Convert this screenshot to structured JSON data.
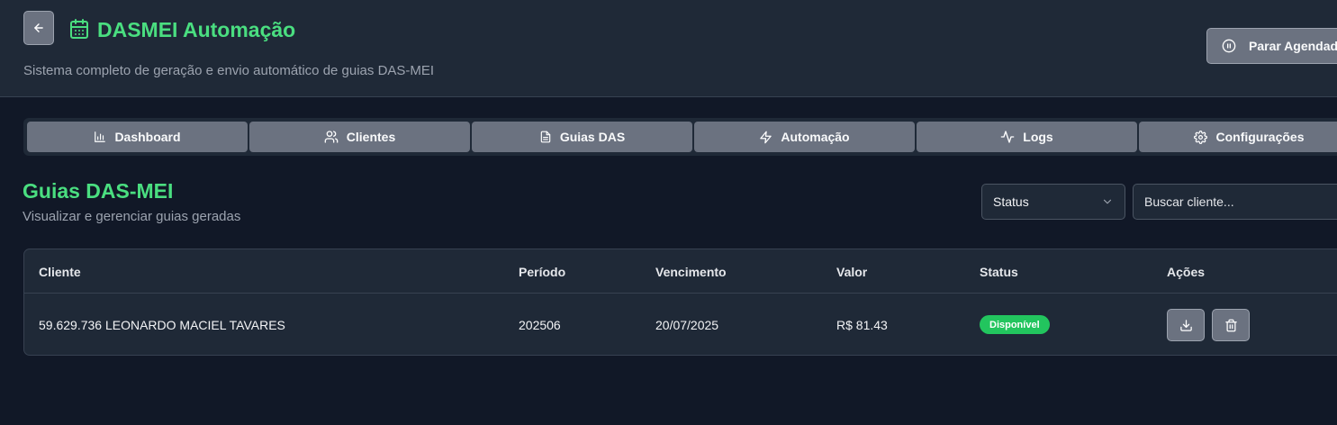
{
  "header": {
    "title": "DASMEI Automação",
    "subtitle": "Sistema completo de geração e envio automático de guias DAS-MEI",
    "stop_button": "Parar Agendador"
  },
  "tabs": [
    {
      "label": "Dashboard",
      "icon": "bar-chart-icon"
    },
    {
      "label": "Clientes",
      "icon": "users-icon"
    },
    {
      "label": "Guias DAS",
      "icon": "file-text-icon"
    },
    {
      "label": "Automação",
      "icon": "zap-icon"
    },
    {
      "label": "Logs",
      "icon": "activity-icon"
    },
    {
      "label": "Configurações",
      "icon": "gear-icon"
    }
  ],
  "section": {
    "title": "Guias DAS-MEI",
    "subtitle": "Visualizar e gerenciar guias geradas"
  },
  "filters": {
    "status_label": "Status",
    "search_placeholder": "Buscar cliente..."
  },
  "table": {
    "headers": {
      "cliente": "Cliente",
      "periodo": "Período",
      "vencimento": "Vencimento",
      "valor": "Valor",
      "status": "Status",
      "acoes": "Ações"
    },
    "rows": [
      {
        "cliente": "59.629.736 LEONARDO MACIEL TAVARES",
        "periodo": "202506",
        "vencimento": "20/07/2025",
        "valor": "R$ 81.43",
        "status": "Disponível"
      }
    ]
  },
  "colors": {
    "accent": "#4ade80",
    "badge": "#22c55e",
    "background": "#111827",
    "panel": "#1f2937",
    "button": "#6b7280"
  }
}
